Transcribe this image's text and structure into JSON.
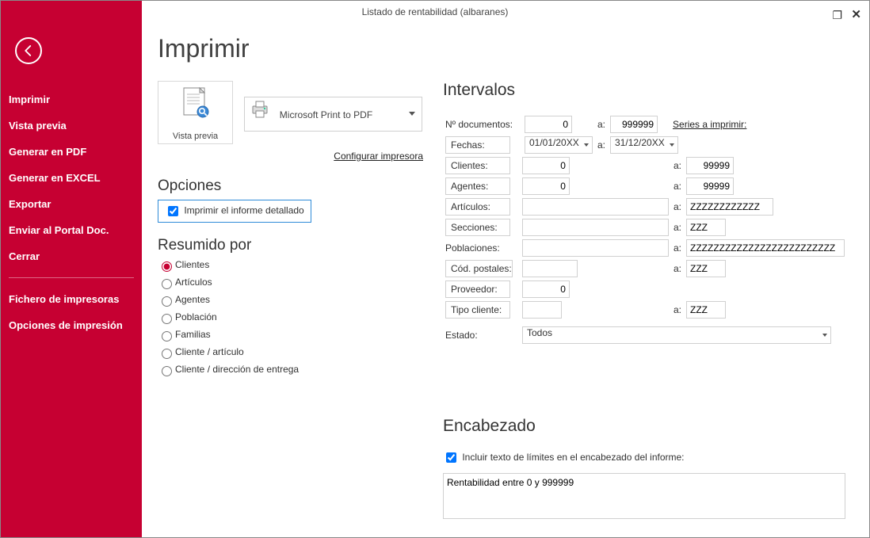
{
  "window": {
    "title": "Listado de rentabilidad (albaranes)"
  },
  "sidebar": {
    "items1": [
      {
        "label": "Imprimir"
      },
      {
        "label": "Vista previa"
      },
      {
        "label": "Generar en PDF"
      },
      {
        "label": "Generar en EXCEL"
      },
      {
        "label": "Exportar"
      },
      {
        "label": "Enviar al Portal Doc."
      },
      {
        "label": "Cerrar"
      }
    ],
    "items2": [
      {
        "label": "Fichero de impresoras"
      },
      {
        "label": "Opciones de impresión"
      }
    ]
  },
  "page_title": "Imprimir",
  "preview": {
    "label": "Vista previa"
  },
  "printer": {
    "name": "Microsoft Print to PDF",
    "config_link": "Configurar impresora"
  },
  "opciones": {
    "title": "Opciones",
    "detail_label": "Imprimir el informe detallado",
    "detail_checked": true
  },
  "resumido": {
    "title": "Resumido por",
    "options": [
      "Clientes",
      "Artículos",
      "Agentes",
      "Población",
      "Familias",
      "Cliente / artículo",
      "Cliente / dirección de entrega"
    ],
    "selected_index": 0
  },
  "intervalos": {
    "title": "Intervalos",
    "ndocs_label": "Nº documentos:",
    "ndocs_from": "0",
    "ndocs_to": "999999",
    "a_label": "a:",
    "series_link": "Series a imprimir:",
    "fechas_label": "Fechas:",
    "fechas_from": "01/01/20XX",
    "fechas_to": "31/12/20XX",
    "clientes_label": "Clientes:",
    "clientes_from": "0",
    "clientes_to": "99999",
    "agentes_label": "Agentes:",
    "agentes_from": "0",
    "agentes_to": "99999",
    "articulos_label": "Artículos:",
    "articulos_from": "",
    "articulos_to": "ZZZZZZZZZZZZ",
    "secciones_label": "Secciones:",
    "secciones_from": "",
    "secciones_to": "ZZZ",
    "poblaciones_label": "Poblaciones:",
    "poblaciones_from": "",
    "poblaciones_to": "ZZZZZZZZZZZZZZZZZZZZZZZZZ",
    "cp_label": "Cód. postales:",
    "cp_from": "",
    "cp_to": "ZZZ",
    "proveedor_label": "Proveedor:",
    "proveedor_val": "0",
    "tipocli_label": "Tipo cliente:",
    "tipocli_from": "",
    "tipocli_to": "ZZZ",
    "estado_label": "Estado:",
    "estado_val": "Todos"
  },
  "encabezado": {
    "title": "Encabezado",
    "include_label": "Incluir texto de límites en el encabezado del informe:",
    "include_checked": true,
    "text": "Rentabilidad entre 0 y 999999"
  }
}
